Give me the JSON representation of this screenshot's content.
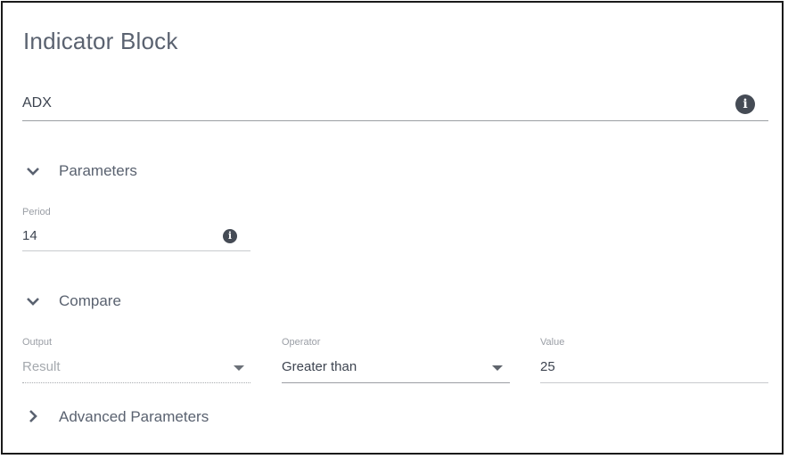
{
  "block": {
    "title": "Indicator Block",
    "indicator": {
      "value": "ADX",
      "icon": "info-icon"
    }
  },
  "sections": {
    "parameters": {
      "label": "Parameters",
      "expanded": true,
      "icon": "chevron-down-icon",
      "fields": {
        "period": {
          "label": "Period",
          "value": "14",
          "icon": "info-icon"
        }
      }
    },
    "compare": {
      "label": "Compare",
      "expanded": true,
      "icon": "chevron-down-icon",
      "fields": {
        "output": {
          "label": "Output",
          "value": "Result",
          "disabled": true,
          "icon": "caret-down-icon"
        },
        "operator": {
          "label": "Operator",
          "value": "Greater than",
          "icon": "caret-down-icon"
        },
        "value": {
          "label": "Value",
          "value": "25"
        }
      }
    },
    "advanced": {
      "label": "Advanced Parameters",
      "expanded": false,
      "icon": "chevron-right-icon"
    }
  },
  "info_glyph": "i"
}
